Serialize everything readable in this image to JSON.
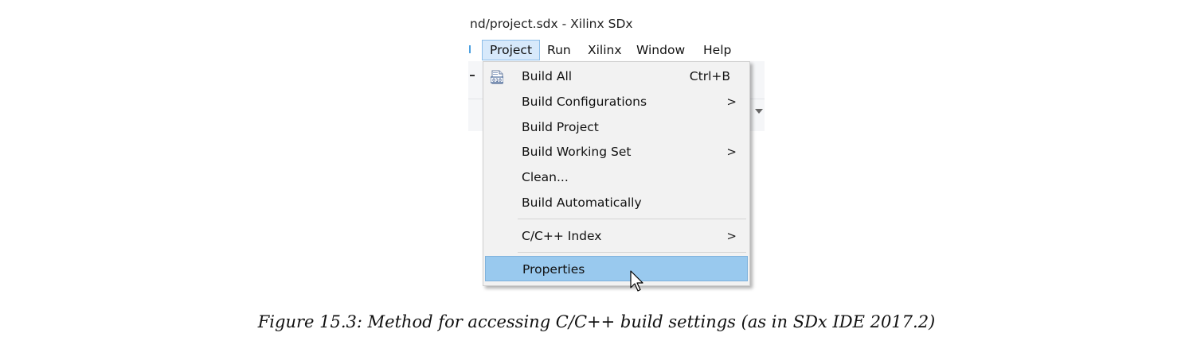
{
  "window": {
    "title": "nd/project.sdx - Xilinx SDx"
  },
  "menubar": {
    "items": [
      {
        "label": "Project",
        "active": true
      },
      {
        "label": "Run"
      },
      {
        "label": "Xilinx"
      },
      {
        "label": "Window"
      },
      {
        "label": "Help"
      }
    ]
  },
  "project_menu": {
    "items": [
      {
        "label": "Build All",
        "shortcut": "Ctrl+B",
        "icon": "binary-file-icon"
      },
      {
        "label": "Build Configurations",
        "submenu_arrow": ">"
      },
      {
        "label": "Build Project"
      },
      {
        "label": "Build Working Set",
        "submenu_arrow": ">"
      },
      {
        "label": "Clean..."
      },
      {
        "label": "Build Automatically"
      },
      {
        "label": "C/C++ Index",
        "submenu_arrow": ">"
      },
      {
        "label": "Properties",
        "highlighted": true
      }
    ],
    "icon_text": "010"
  },
  "colors": {
    "menu_bg": "#f2f2f2",
    "highlight": "#99c9ee",
    "active_menubar": "#d7e9fb"
  },
  "caption": "Figure 15.3:  Method for accessing C/C++ build settings (as in SDx IDE 2017.2)"
}
